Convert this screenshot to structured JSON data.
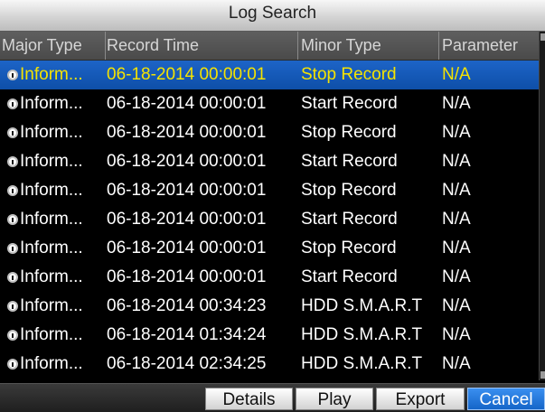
{
  "window": {
    "title": "Log Search"
  },
  "columns": [
    "Major Type",
    "Record Time",
    "Minor Type",
    "Parameter"
  ],
  "rows": [
    {
      "major": "Inform...",
      "time": "06-18-2014 00:00:01",
      "minor": "Stop Record",
      "param": "N/A",
      "selected": true
    },
    {
      "major": "Inform...",
      "time": "06-18-2014 00:00:01",
      "minor": "Start Record",
      "param": "N/A"
    },
    {
      "major": "Inform...",
      "time": "06-18-2014 00:00:01",
      "minor": "Stop Record",
      "param": "N/A"
    },
    {
      "major": "Inform...",
      "time": "06-18-2014 00:00:01",
      "minor": "Start Record",
      "param": "N/A"
    },
    {
      "major": "Inform...",
      "time": "06-18-2014 00:00:01",
      "minor": "Stop Record",
      "param": "N/A"
    },
    {
      "major": "Inform...",
      "time": "06-18-2014 00:00:01",
      "minor": "Start Record",
      "param": "N/A"
    },
    {
      "major": "Inform...",
      "time": "06-18-2014 00:00:01",
      "minor": "Stop Record",
      "param": "N/A"
    },
    {
      "major": "Inform...",
      "time": "06-18-2014 00:00:01",
      "minor": "Start Record",
      "param": "N/A"
    },
    {
      "major": "Inform...",
      "time": "06-18-2014 00:34:23",
      "minor": "HDD S.M.A.R.T",
      "param": "N/A"
    },
    {
      "major": "Inform...",
      "time": "06-18-2014 01:34:24",
      "minor": "HDD S.M.A.R.T",
      "param": "N/A"
    },
    {
      "major": "Inform...",
      "time": "06-18-2014 02:34:25",
      "minor": "HDD S.M.A.R.T",
      "param": "N/A"
    }
  ],
  "buttons": {
    "details": "Details",
    "play": "Play",
    "export": "Export",
    "cancel": "Cancel"
  },
  "icons": {
    "row_icon": "info-icon"
  },
  "colors": {
    "selected_row": "#1459b8",
    "selected_text": "#f5e300",
    "active_button": "#2a7ee0"
  }
}
